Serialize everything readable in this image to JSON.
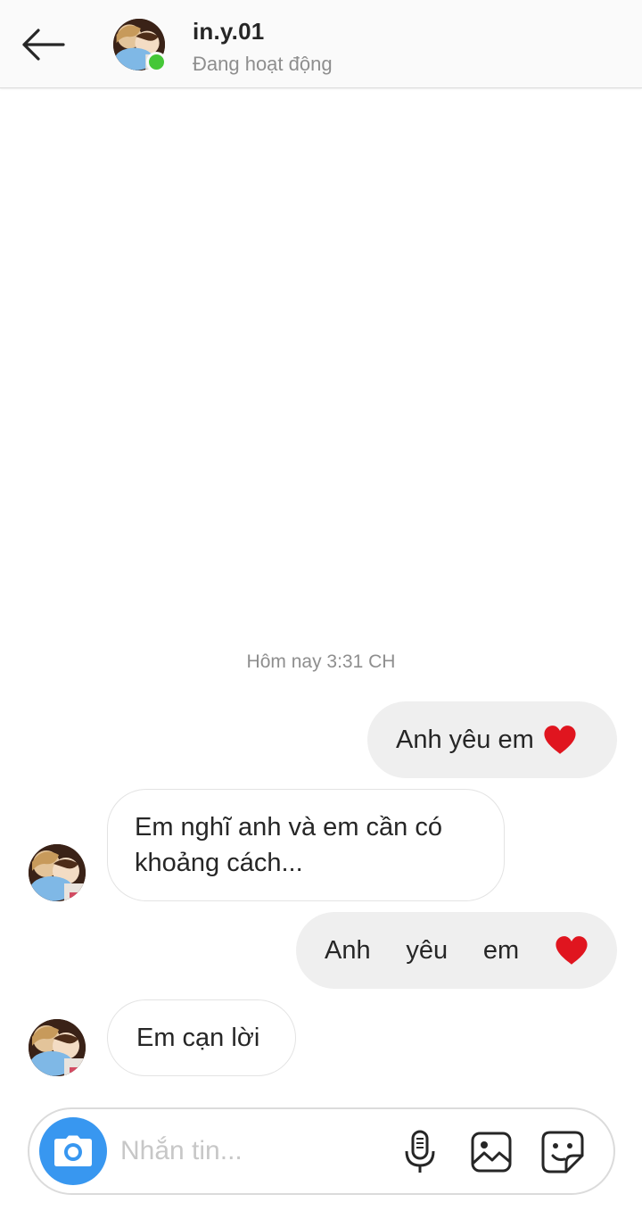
{
  "header": {
    "username": "in.y.01",
    "status": "Đang hoạt động",
    "back_icon": "arrow-left-icon",
    "online_color": "#45c737"
  },
  "thread": {
    "timestamp": "Hôm nay 3:31 CH",
    "messages": [
      {
        "direction": "sent",
        "text": "Anh yêu em",
        "emoji": "heart-icon"
      },
      {
        "direction": "received",
        "lines": [
          "Em nghĩ anh và em cần có",
          "khoảng cách..."
        ]
      },
      {
        "direction": "sent",
        "words": [
          "Anh",
          "yêu",
          "em"
        ],
        "emoji": "heart-icon"
      },
      {
        "direction": "received",
        "text": "Em cạn lời"
      }
    ]
  },
  "composer": {
    "placeholder": "Nhắn tin...",
    "camera_color": "#3897f0",
    "icons": [
      "camera-icon",
      "microphone-icon",
      "image-icon",
      "sticker-icon"
    ]
  },
  "colors": {
    "sent_bubble": "#efefef",
    "received_border": "#e3e3e3",
    "heart": "#e0151f"
  }
}
